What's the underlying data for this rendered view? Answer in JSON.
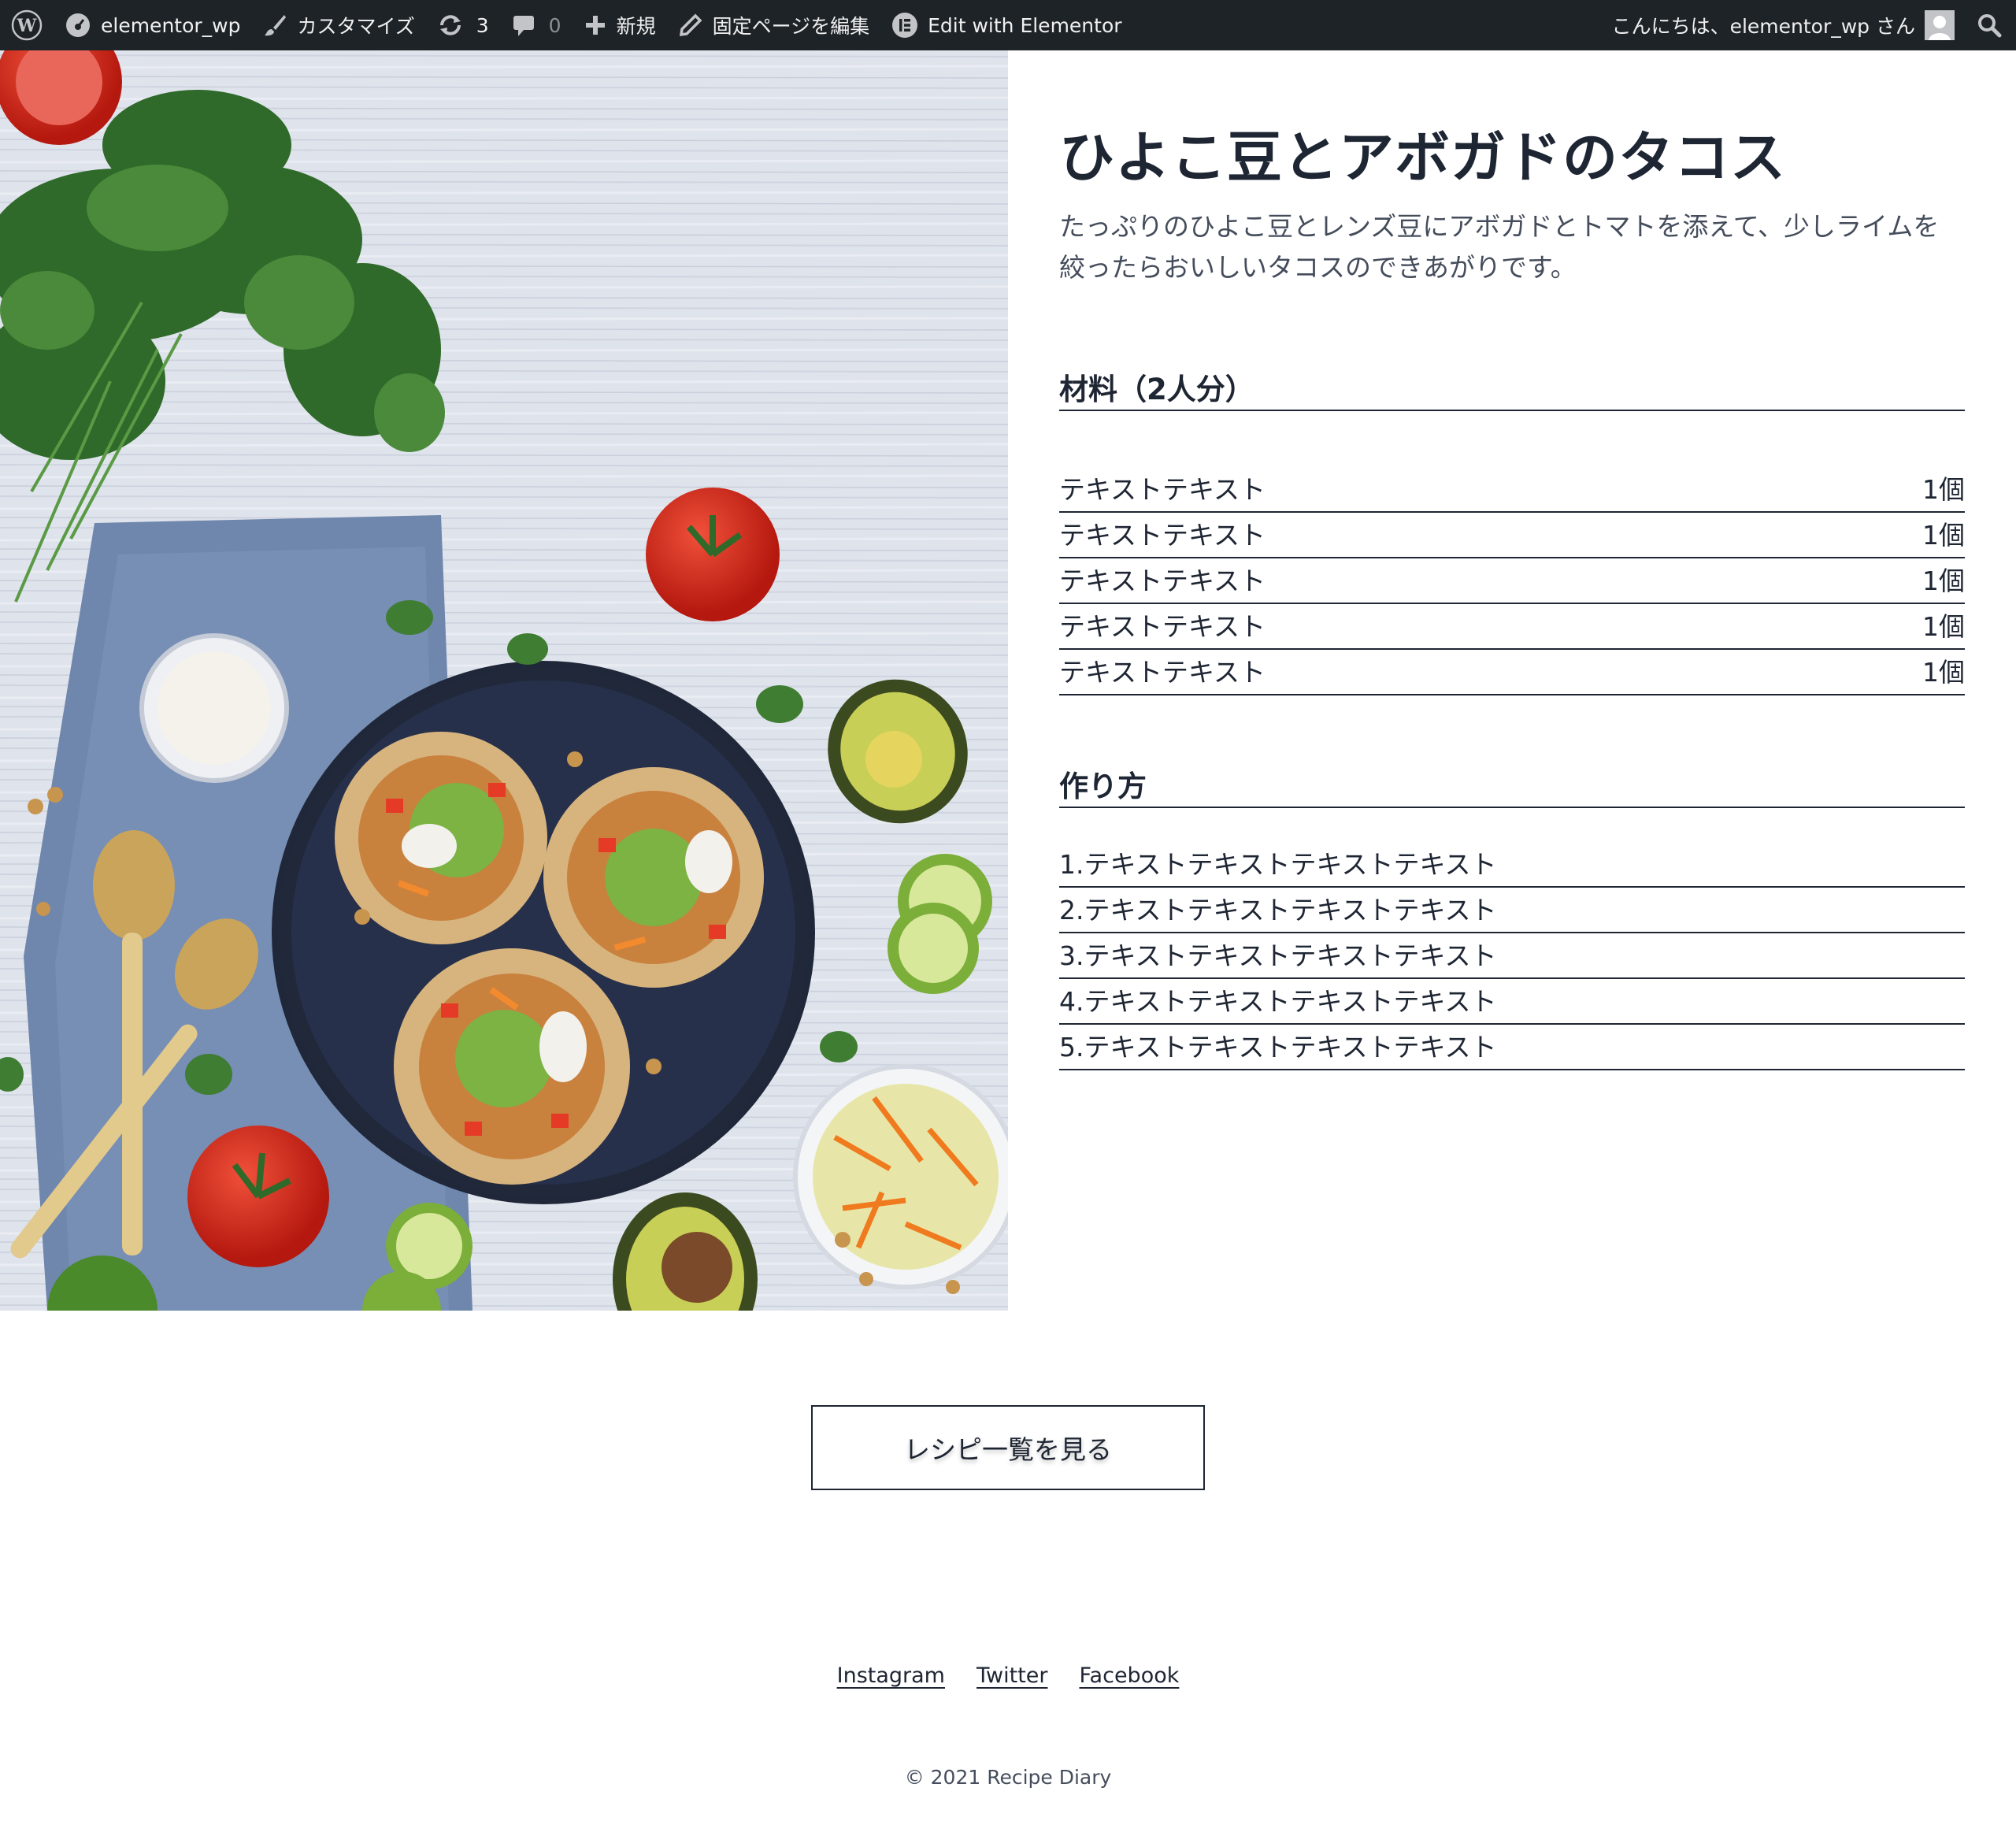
{
  "admin_bar": {
    "site_name": "elementor_wp",
    "customize": "カスタマイズ",
    "updates_count": "3",
    "comments_count": "0",
    "new": "新規",
    "edit_page": "固定ページを編集",
    "edit_elementor": "Edit with Elementor",
    "greeting": "こんにちは、elementor_wp さん"
  },
  "recipe": {
    "title": "ひよこ豆とアボガドのタコス",
    "description": "たっぷりのひよこ豆とレンズ豆にアボガドとトマトを添えて、少しライムを絞ったらおいしいタコスのできあがりです。",
    "ingredients_heading": "材料（2人分）",
    "ingredients": [
      {
        "name": "テキストテキスト",
        "qty": "1個"
      },
      {
        "name": "テキストテキスト",
        "qty": "1個"
      },
      {
        "name": "テキストテキスト",
        "qty": "1個"
      },
      {
        "name": "テキストテキスト",
        "qty": "1個"
      },
      {
        "name": "テキストテキスト",
        "qty": "1個"
      }
    ],
    "steps_heading": "作り方",
    "steps": [
      "1.テキストテキストテキストテキスト",
      "2.テキストテキストテキストテキスト",
      "3.テキストテキストテキストテキスト",
      "4.テキストテキストテキストテキスト",
      "5.テキストテキストテキストテキスト"
    ]
  },
  "cta_label": "レシピ一覧を見る",
  "footer": {
    "links": [
      "Instagram",
      "Twitter",
      "Facebook"
    ],
    "copyright": "© 2021 Recipe Diary"
  },
  "colors": {
    "admin_bar_bg": "#1d2327",
    "text_primary": "#1e2533",
    "text_secondary": "#454d5c"
  }
}
